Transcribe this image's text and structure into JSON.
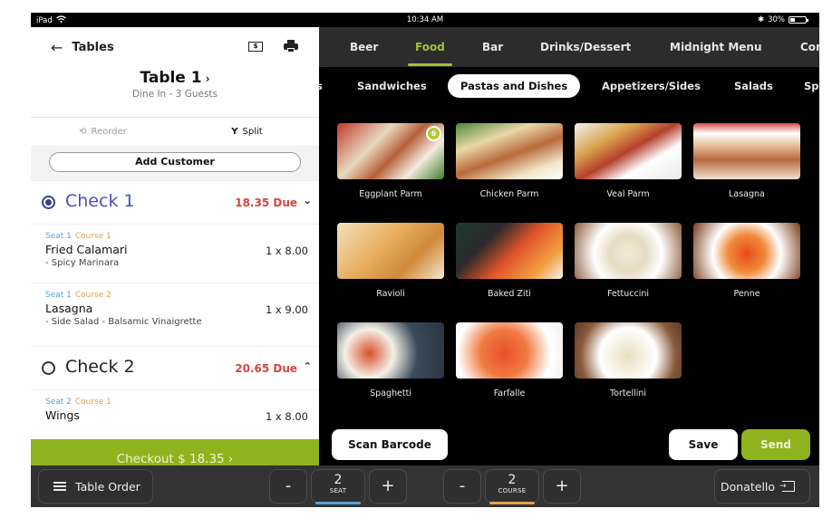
{
  "status_bar": {
    "device": "iPad",
    "time": "10:34 AM",
    "battery_text": "30%",
    "battery_level": 0.3
  },
  "left_panel": {
    "back_label": "Tables",
    "table_title": "Table 1",
    "table_subtitle": "Dine In - 3 Guests",
    "reorder_label": "Reorder",
    "split_label": "Split",
    "add_customer_label": "Add Customer",
    "checks": [
      {
        "name": "Check 1",
        "due": "18.35 Due",
        "selected": true,
        "expanded": true,
        "items": [
          {
            "seat": "Seat 1",
            "course": "Course 1",
            "name": "Fried Calamari",
            "qty_price": "1 x 8.00",
            "modifiers": "- Spicy Marinara"
          },
          {
            "seat": "Seat 1",
            "course": "Course 2",
            "name": "Lasagna",
            "qty_price": "1 x 9.00",
            "modifiers": "- Side Salad - Balsamic Vinaigrette"
          }
        ]
      },
      {
        "name": "Check 2",
        "due": "20.65 Due",
        "selected": false,
        "expanded": false,
        "items": [
          {
            "seat": "Seat 2",
            "course": "Course 1",
            "name": "Wings",
            "qty_price": "1 x 8.00"
          }
        ]
      }
    ],
    "checkout_label": "Checkout $ 18.35 ›"
  },
  "menu": {
    "categories": [
      "Beer",
      "Food",
      "Bar",
      "Drinks/Dessert",
      "Midnight Menu",
      "Cor"
    ],
    "active_category": "Food",
    "subcategories": [
      "s",
      "Sandwiches",
      "Pastas and Dishes",
      "Appetizers/Sides",
      "Salads",
      "Sp"
    ],
    "active_subcategory": "Pastas and Dishes",
    "items": [
      {
        "name": "Eggplant Parm",
        "badge": "6"
      },
      {
        "name": "Chicken Parm"
      },
      {
        "name": "Veal Parm"
      },
      {
        "name": "Lasagna"
      },
      {
        "name": "Ravioli"
      },
      {
        "name": "Baked Ziti"
      },
      {
        "name": "Fettuccini"
      },
      {
        "name": "Penne"
      },
      {
        "name": "Spaghetti"
      },
      {
        "name": "Farfalle"
      },
      {
        "name": "Tortellini"
      }
    ],
    "scan_barcode_label": "Scan Barcode",
    "save_label": "Save",
    "send_label": "Send"
  },
  "bottom_bar": {
    "table_order_label": "Table Order",
    "seat": {
      "value": "2",
      "label": "SEAT",
      "minus": "-",
      "plus": "+"
    },
    "course": {
      "value": "2",
      "label": "COURSE",
      "minus": "-",
      "plus": "+"
    },
    "user_label": "Donatello"
  },
  "colors": {
    "accent_green": "#8fb31c",
    "active_tab": "#9fc23a",
    "due_red": "#d9433e",
    "check_selected": "#4d4fc0",
    "seat_blue": "#5aa0d8",
    "course_orange": "#e3a04d"
  }
}
